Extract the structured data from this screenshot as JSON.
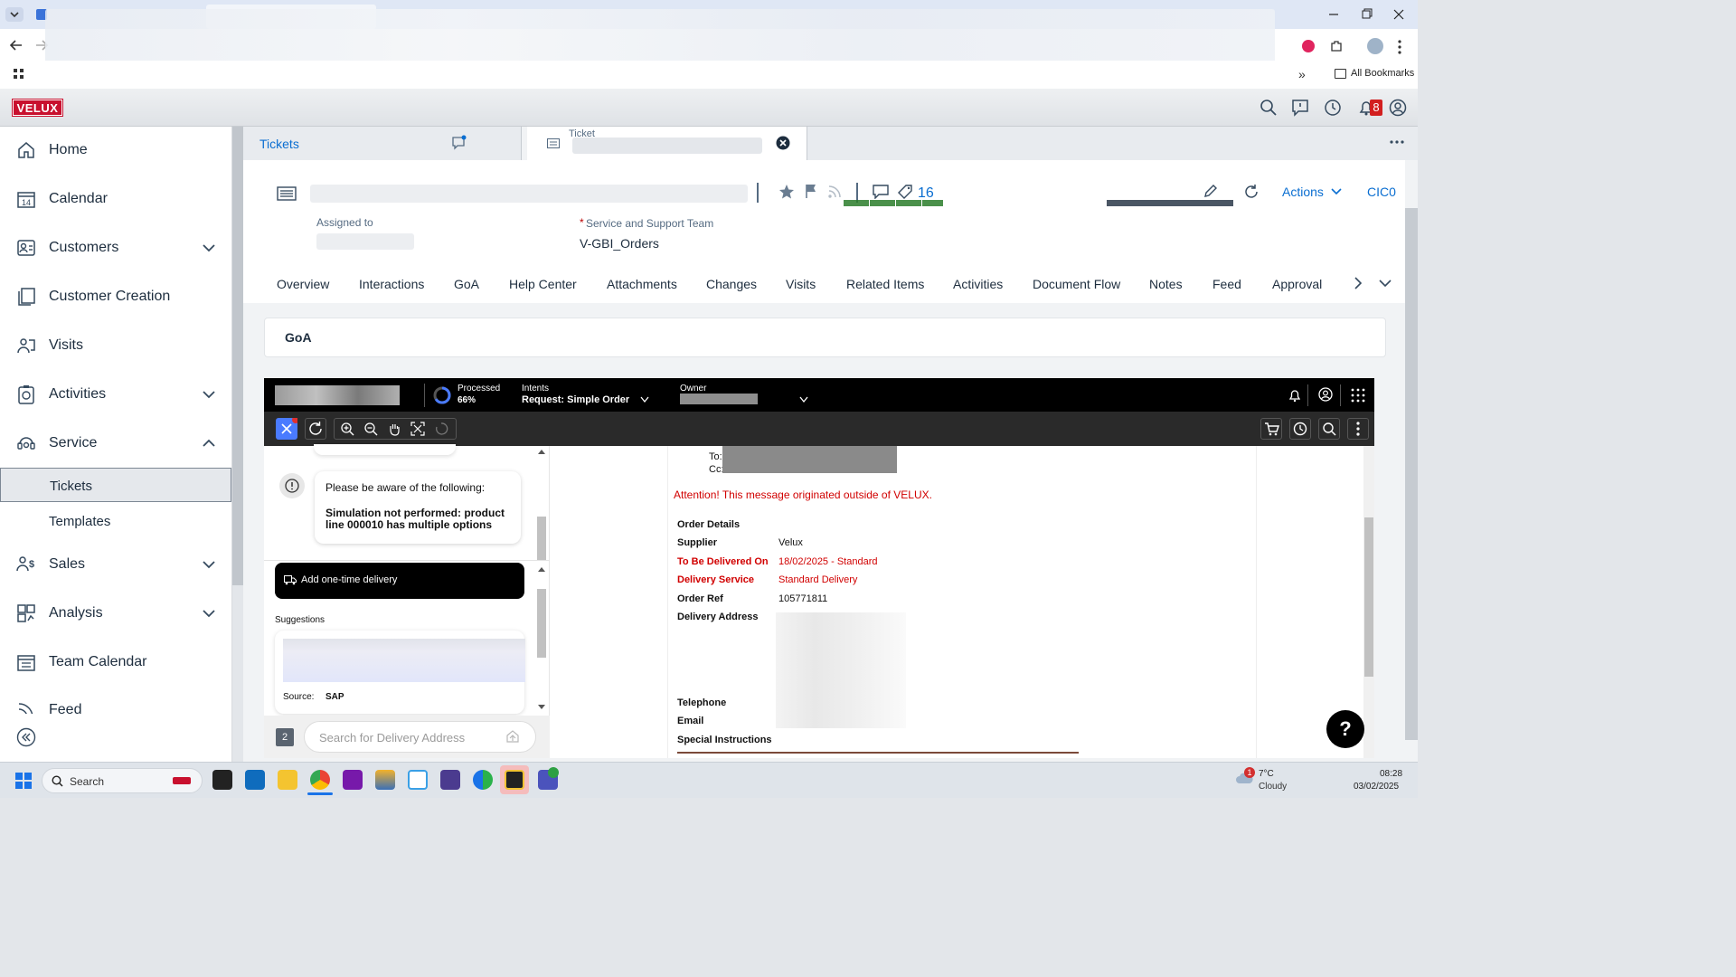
{
  "browser": {
    "bookmarks_label": "All Bookmarks"
  },
  "app": {
    "logo": "VELUX",
    "notification_count": "8"
  },
  "sidebar": {
    "items": [
      {
        "label": "Home",
        "icon": "home-icon"
      },
      {
        "label": "Calendar",
        "icon": "calendar-icon"
      },
      {
        "label": "Customers",
        "icon": "customers-icon"
      },
      {
        "label": "Customer Creation",
        "icon": "copy-icon"
      },
      {
        "label": "Visits",
        "icon": "visits-icon"
      },
      {
        "label": "Activities",
        "icon": "activities-icon"
      },
      {
        "label": "Service",
        "icon": "service-icon"
      },
      {
        "label": "Sales",
        "icon": "sales-icon"
      },
      {
        "label": "Analysis",
        "icon": "analysis-icon"
      },
      {
        "label": "Team Calendar",
        "icon": "team-calendar-icon"
      },
      {
        "label": "Feed",
        "icon": "feed-icon"
      }
    ],
    "service_children": [
      "Tickets",
      "Templates"
    ]
  },
  "tabs": {
    "tickets": "Tickets",
    "ticket": "Ticket"
  },
  "ticket": {
    "tag_count": "16",
    "actions_label": "Actions",
    "user_code": "CIC0",
    "assigned_to_label": "Assigned to",
    "team_label": "Service and Support Team",
    "team_value": "V-GBI_Orders",
    "required_mark": "*",
    "tabs": [
      "Overview",
      "Interactions",
      "GoA",
      "Help Center",
      "Attachments",
      "Changes",
      "Visits",
      "Related Items",
      "Activities",
      "Document Flow",
      "Notes",
      "Feed",
      "Approval"
    ],
    "section_title": "GoA"
  },
  "embedded": {
    "processed_label": "Processed",
    "processed_value": "66%",
    "processed_fraction": 0.66,
    "intents_label": "Intents",
    "intents_value": "Request: Simple Order",
    "owner_label": "Owner",
    "notice_title": "Please be aware of the following:",
    "notice_body": "Simulation not performed: product line 000010 has multiple options",
    "add_delivery": "Add one-time delivery",
    "suggestions_label": "Suggestions",
    "source_label": "Source:",
    "source_value": "SAP",
    "step_number": "2",
    "search_placeholder": "Search for Delivery Address"
  },
  "email": {
    "to_label": "To:",
    "cc_label": "Cc:",
    "warning": "Attention! This message originated outside of VELUX.",
    "order_details": "Order Details",
    "fields": [
      {
        "label": "Supplier",
        "value": "Velux"
      },
      {
        "label": "To Be Delivered On",
        "value": "18/02/2025 - Standard"
      },
      {
        "label": "Delivery Service",
        "value": "Standard Delivery"
      },
      {
        "label": "Order Ref",
        "value": "105771811"
      },
      {
        "label": "Delivery Address",
        "value": ""
      },
      {
        "label": "Telephone",
        "value": ""
      },
      {
        "label": "Email",
        "value": ""
      },
      {
        "label": "Special Instructions",
        "value": ""
      }
    ]
  },
  "help_button": "?",
  "taskbar": {
    "search_placeholder": "Search",
    "weather_temp": "7°C",
    "weather_desc": "Cloudy",
    "weather_badge": "1",
    "time": "08:28",
    "date": "03/02/2025"
  },
  "colors": {
    "brand_red": "#c8102e",
    "accent_blue": "#0a6ed1",
    "warning_red": "#d10000"
  }
}
